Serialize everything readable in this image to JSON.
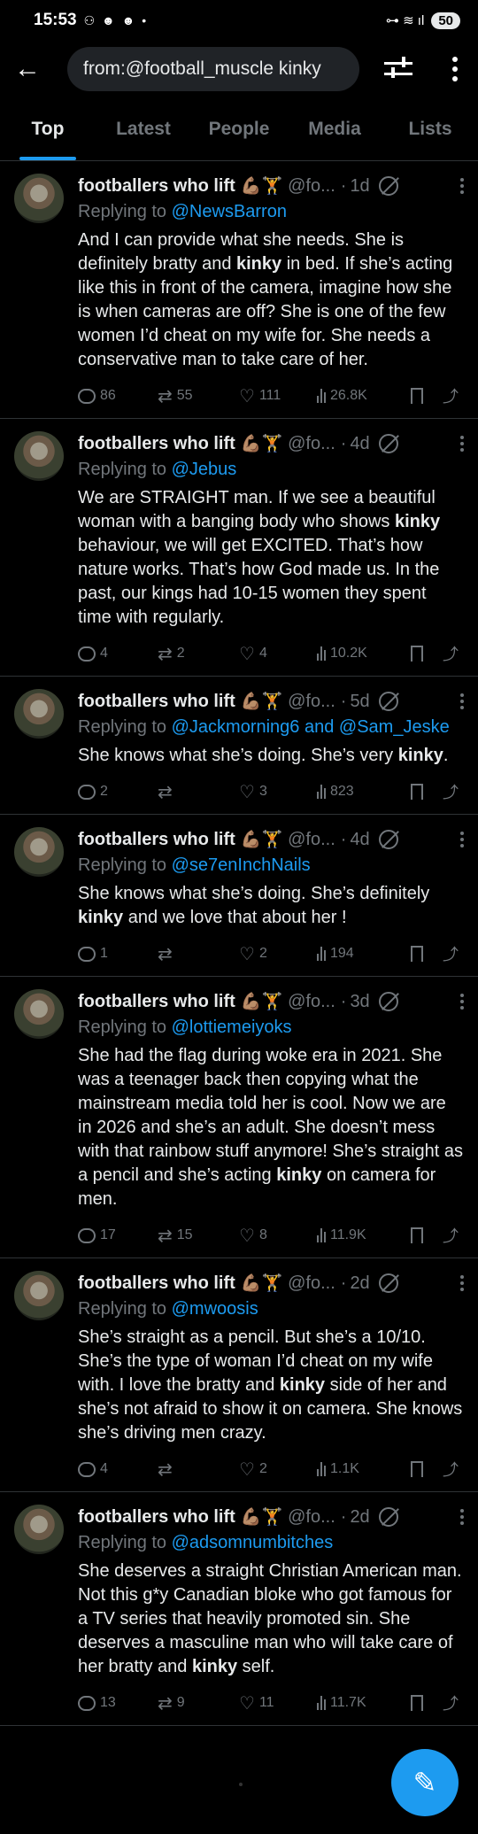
{
  "status": {
    "time": "15:53",
    "notif_icons": "⚇ ☻ ☻ •",
    "right_icons": "⊶ ≋ ıl",
    "battery": "50"
  },
  "search": {
    "query": "from:@football_muscle kinky"
  },
  "tabs": [
    "Top",
    "Latest",
    "People",
    "Media",
    "Lists"
  ],
  "icon_names": [
    "back-arrow-icon",
    "filter-icon",
    "more-vert-icon",
    "grok-icon",
    "reply-icon",
    "retweet-icon",
    "like-icon",
    "views-icon",
    "bookmark-icon",
    "share-icon",
    "compose-icon"
  ],
  "accent": "#1d9bf0",
  "tweets": [
    {
      "name": "footballers who lift",
      "emoji": "💪🏽🏋️",
      "handle": "@fo...",
      "age": "1d",
      "replying_prefix": "Replying to",
      "replying_to": "@NewsBarron",
      "text_parts": [
        "And I can provide what she needs. She is definitely bratty and ",
        "kinky",
        " in bed. If she’s acting like this in front of the camera, imagine how she is when cameras are off? She is one of the few women I’d cheat on my wife for. She needs a conservative man to take care of her."
      ],
      "replies": "86",
      "retweets": "55",
      "likes": "111",
      "views": "26.8K"
    },
    {
      "name": "footballers who lift",
      "emoji": "💪🏽🏋️",
      "handle": "@fo...",
      "age": "4d",
      "replying_prefix": "Replying to",
      "replying_to": "@Jebus",
      "text_parts": [
        "We are STRAIGHT man. If we see a beautiful woman with a banging body who shows ",
        "kinky",
        " behaviour, we will get EXCITED. That’s how nature works. That’s how God made us. In the past, our kings had 10-15 women they spent time with regularly."
      ],
      "replies": "4",
      "retweets": "2",
      "likes": "4",
      "views": "10.2K"
    },
    {
      "name": "footballers who lift",
      "emoji": "💪🏽🏋️",
      "handle": "@fo...",
      "age": "5d",
      "replying_prefix": "Replying to",
      "replying_to": "@Jackmorning6 and @Sam_Jeske",
      "text_parts": [
        "She knows what she’s doing. She’s very ",
        "kinky",
        "."
      ],
      "replies": "2",
      "retweets": "",
      "likes": "3",
      "views": "823"
    },
    {
      "name": "footballers who lift",
      "emoji": "💪🏽🏋️",
      "handle": "@fo...",
      "age": "4d",
      "replying_prefix": "Replying to",
      "replying_to": "@se7enInchNails",
      "text_parts": [
        "She knows what she’s doing. She’s definitely ",
        "kinky",
        " and we love that about her !"
      ],
      "replies": "1",
      "retweets": "",
      "likes": "2",
      "views": "194"
    },
    {
      "name": "footballers who lift",
      "emoji": "💪🏽🏋️",
      "handle": "@fo...",
      "age": "3d",
      "replying_prefix": "Replying to",
      "replying_to": "@lottiemeiyoks",
      "text_parts": [
        "She had the flag during woke era in 2021. She was a teenager back then copying what the mainstream media told her is cool. Now we are in 2026 and she’s an adult. She doesn’t mess with that rainbow stuff anymore! She’s straight as a pencil and she’s acting ",
        "kinky",
        " on camera for men."
      ],
      "replies": "17",
      "retweets": "15",
      "likes": "8",
      "views": "11.9K"
    },
    {
      "name": "footballers who lift",
      "emoji": "💪🏽🏋️",
      "handle": "@fo...",
      "age": "2d",
      "replying_prefix": "Replying to",
      "replying_to": "@mwoosis",
      "text_parts": [
        "She’s straight as a pencil. But she’s a 10/10. She’s the type of woman I’d cheat on my wife with. I love the bratty and ",
        "kinky",
        " side of her and she’s not afraid to show it on camera. She knows she’s driving men crazy."
      ],
      "replies": "4",
      "retweets": "",
      "likes": "2",
      "views": "1.1K"
    },
    {
      "name": "footballers who lift",
      "emoji": "💪🏽🏋️",
      "handle": "@fo...",
      "age": "2d",
      "replying_prefix": "Replying to",
      "replying_to": "@adsomnumbitches",
      "text_parts": [
        "She deserves a straight Christian American man. Not this g*y Canadian bloke who got famous for a TV series that heavily promoted sin. She deserves a masculine man who will take care of her bratty and ",
        "kinky",
        " self."
      ],
      "replies": "13",
      "retweets": "9",
      "likes": "11",
      "views": "11.7K"
    }
  ]
}
